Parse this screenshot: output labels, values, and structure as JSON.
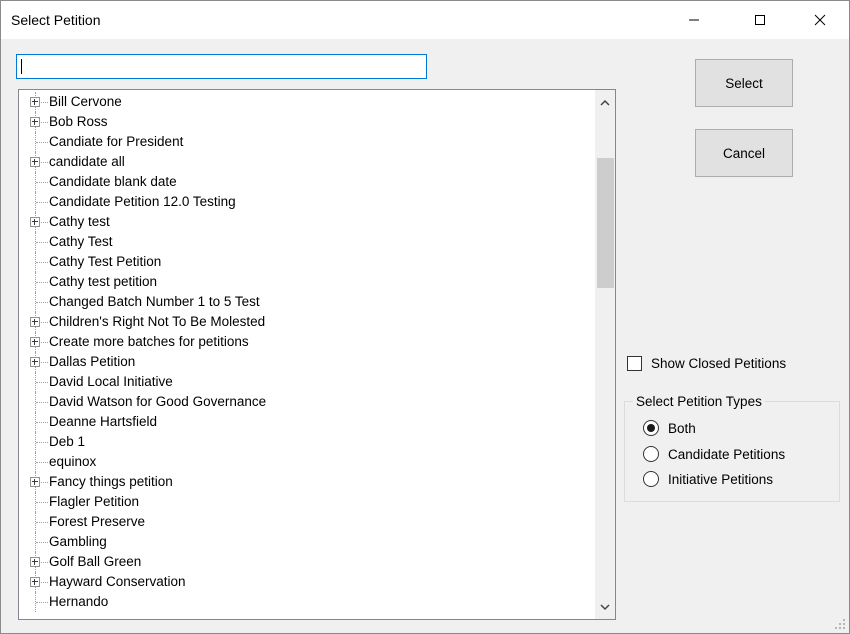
{
  "window": {
    "title": "Select Petition",
    "controls": [
      "minimize-icon",
      "maximize-icon",
      "close-icon"
    ]
  },
  "search": {
    "value": "",
    "placeholder": ""
  },
  "tree": {
    "items": [
      {
        "label": "Bill Cervone",
        "expandable": true
      },
      {
        "label": "Bob Ross",
        "expandable": true
      },
      {
        "label": "Candiate for President",
        "expandable": false
      },
      {
        "label": "candidate all",
        "expandable": true
      },
      {
        "label": "Candidate blank date",
        "expandable": false
      },
      {
        "label": "Candidate Petition 12.0 Testing",
        "expandable": false
      },
      {
        "label": "Cathy test",
        "expandable": true
      },
      {
        "label": "Cathy Test",
        "expandable": false
      },
      {
        "label": "Cathy Test Petition",
        "expandable": false
      },
      {
        "label": "Cathy test petition",
        "expandable": false
      },
      {
        "label": "Changed Batch Number 1 to 5 Test",
        "expandable": false
      },
      {
        "label": "Children's Right Not To Be Molested",
        "expandable": true
      },
      {
        "label": "Create more batches for petitions",
        "expandable": true
      },
      {
        "label": "Dallas Petition",
        "expandable": true
      },
      {
        "label": "David Local Initiative",
        "expandable": false
      },
      {
        "label": "David Watson for Good Governance",
        "expandable": false
      },
      {
        "label": "Deanne Hartsfield",
        "expandable": false
      },
      {
        "label": "Deb 1",
        "expandable": false
      },
      {
        "label": "equinox",
        "expandable": false
      },
      {
        "label": "Fancy things petition",
        "expandable": true
      },
      {
        "label": "Flagler Petition",
        "expandable": false
      },
      {
        "label": "Forest Preserve",
        "expandable": false
      },
      {
        "label": "Gambling",
        "expandable": false
      },
      {
        "label": "Golf Ball Green",
        "expandable": true
      },
      {
        "label": "Hayward Conservation",
        "expandable": true
      },
      {
        "label": "Hernando",
        "expandable": false
      }
    ]
  },
  "buttons": {
    "select": "Select",
    "cancel": "Cancel"
  },
  "options": {
    "show_closed_label": "Show Closed Petitions",
    "show_closed_checked": false
  },
  "petition_types": {
    "legend": "Select Petition Types",
    "options": [
      {
        "label": "Both",
        "checked": true
      },
      {
        "label": "Candidate Petitions",
        "checked": false
      },
      {
        "label": "Initiative Petitions",
        "checked": false
      }
    ]
  }
}
